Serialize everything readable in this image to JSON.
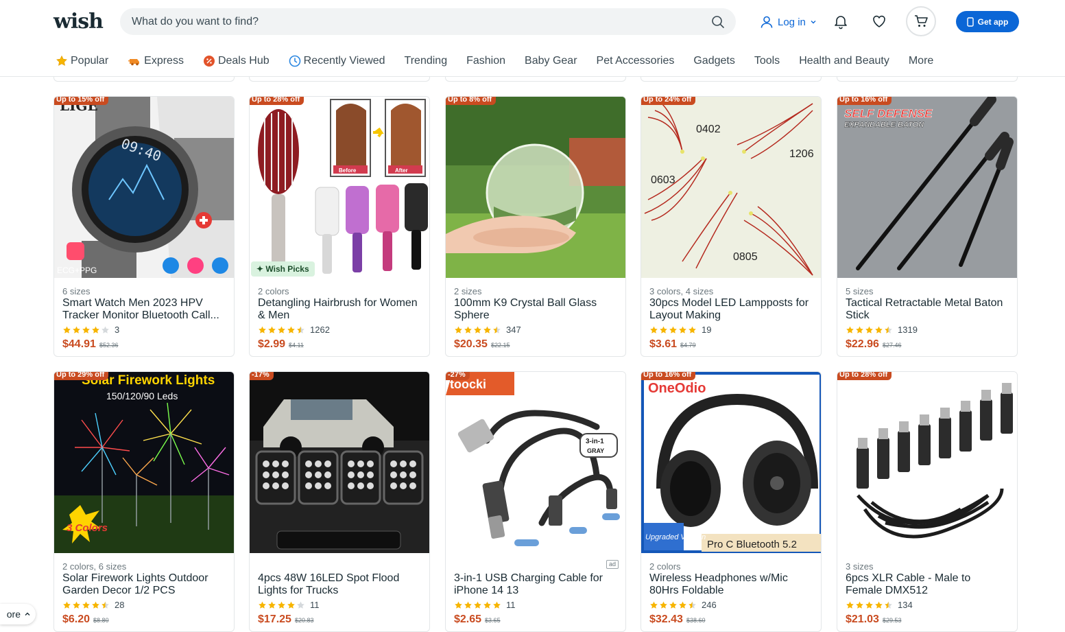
{
  "brand": {
    "logo": "wish",
    "accent": "#0b66d6",
    "discount_color": "#c94b20"
  },
  "search": {
    "placeholder": "What do you want to find?"
  },
  "header": {
    "login_label": "Log in",
    "get_app_label": "Get app"
  },
  "nav": [
    {
      "label": "Popular",
      "icon": "star-icon"
    },
    {
      "label": "Express",
      "icon": "express-icon"
    },
    {
      "label": "Deals Hub",
      "icon": "deals-icon"
    },
    {
      "label": "Recently Viewed",
      "icon": "clock-icon"
    },
    {
      "label": "Trending"
    },
    {
      "label": "Fashion"
    },
    {
      "label": "Baby Gear"
    },
    {
      "label": "Pet Accessories"
    },
    {
      "label": "Gadgets"
    },
    {
      "label": "Tools"
    },
    {
      "label": "Health and Beauty"
    },
    {
      "label": "More"
    }
  ],
  "products": [
    {
      "badge": "Up to 15% off",
      "variants": "6 sizes",
      "title": "Smart Watch Men 2023 HPV Tracker Monitor Bluetooth Call...",
      "rating": 4,
      "reviews": "3",
      "price": "$44.91",
      "was": "$52.36",
      "image": "smart-watch-image"
    },
    {
      "badge": "Up to 28% off",
      "variants": "2 colors",
      "title": "Detangling Hairbrush for Women & Men",
      "rating": 4.5,
      "reviews": "1262",
      "price": "$2.99",
      "was": "$4.11",
      "image": "hairbrush-image",
      "tag": "✦ Wish Picks"
    },
    {
      "badge": "Up to 8% off",
      "variants": "2 sizes",
      "title": "100mm K9 Crystal Ball Glass Sphere",
      "rating": 4.5,
      "reviews": "347",
      "price": "$20.35",
      "was": "$22.15",
      "image": "crystal-ball-image"
    },
    {
      "badge": "Up to 24% off",
      "variants": "3 colors, 4 sizes",
      "title": "30pcs Model LED Lampposts for Layout Making",
      "rating": 5,
      "reviews": "19",
      "price": "$3.61",
      "was": "$4.79",
      "image": "led-lampposts-image"
    },
    {
      "badge": "Up to 16% off",
      "variants": "5 sizes",
      "title": "Tactical Retractable Metal Baton Stick",
      "rating": 4.5,
      "reviews": "1319",
      "price": "$22.96",
      "was": "$27.46",
      "image": "baton-image"
    },
    {
      "badge": "Up to 29% off",
      "variants": "2 colors, 6 sizes",
      "title": "Solar Firework Lights Outdoor Garden Decor 1/2 PCS",
      "rating": 4.5,
      "reviews": "28",
      "price": "$6.20",
      "was": "$8.80",
      "image": "firework-lights-image"
    },
    {
      "badge": "-17%",
      "variants": "",
      "title": "4pcs 48W 16LED Spot Flood Lights for Trucks",
      "rating": 4,
      "reviews": "11",
      "price": "$17.25",
      "was": "$20.83",
      "image": "flood-lights-image"
    },
    {
      "badge": "-27%",
      "variants": "",
      "title": "3-in-1 USB Charging Cable for iPhone 14 13",
      "rating": 5,
      "reviews": "11",
      "price": "$2.65",
      "was": "$3.65",
      "image": "usb-cable-image",
      "ad": "ad"
    },
    {
      "badge": "Up to 16% off",
      "variants": "2 colors",
      "title": "Wireless Headphones w/Mic 80Hrs Foldable",
      "rating": 4.5,
      "reviews": "246",
      "price": "$32.43",
      "was": "$38.60",
      "image": "headphones-image"
    },
    {
      "badge": "Up to 28% off",
      "variants": "3 sizes",
      "title": "6pcs XLR Cable - Male to Female DMX512",
      "rating": 4.5,
      "reviews": "134",
      "price": "$21.03",
      "was": "$29.53",
      "image": "xlr-cable-image"
    }
  ],
  "image_text": {
    "watch_brand": "LIGE",
    "watch_ecg": "ECG+PPG",
    "hair_before": "Before",
    "hair_after": "After",
    "led_0402": "0402",
    "led_1206": "1206",
    "led_0603": "0603",
    "led_0805": "0805",
    "baton_line1": "SELF DEFENSE",
    "baton_line2": "EXPANDABLE BATON",
    "firework_title": "Solar Firework Lights",
    "firework_sub": "150/120/90 Leds",
    "firework_colors": "3 Colors",
    "cable_brand": "toocki",
    "cable_3in1": "3-in-1",
    "cable_gray": "GRAY",
    "phones_brand": "OneOdio",
    "phones_upgraded": "Upgraded Version",
    "phones_model": "Pro C Bluetooth 5.2"
  },
  "floating": {
    "more_label": "ore"
  }
}
